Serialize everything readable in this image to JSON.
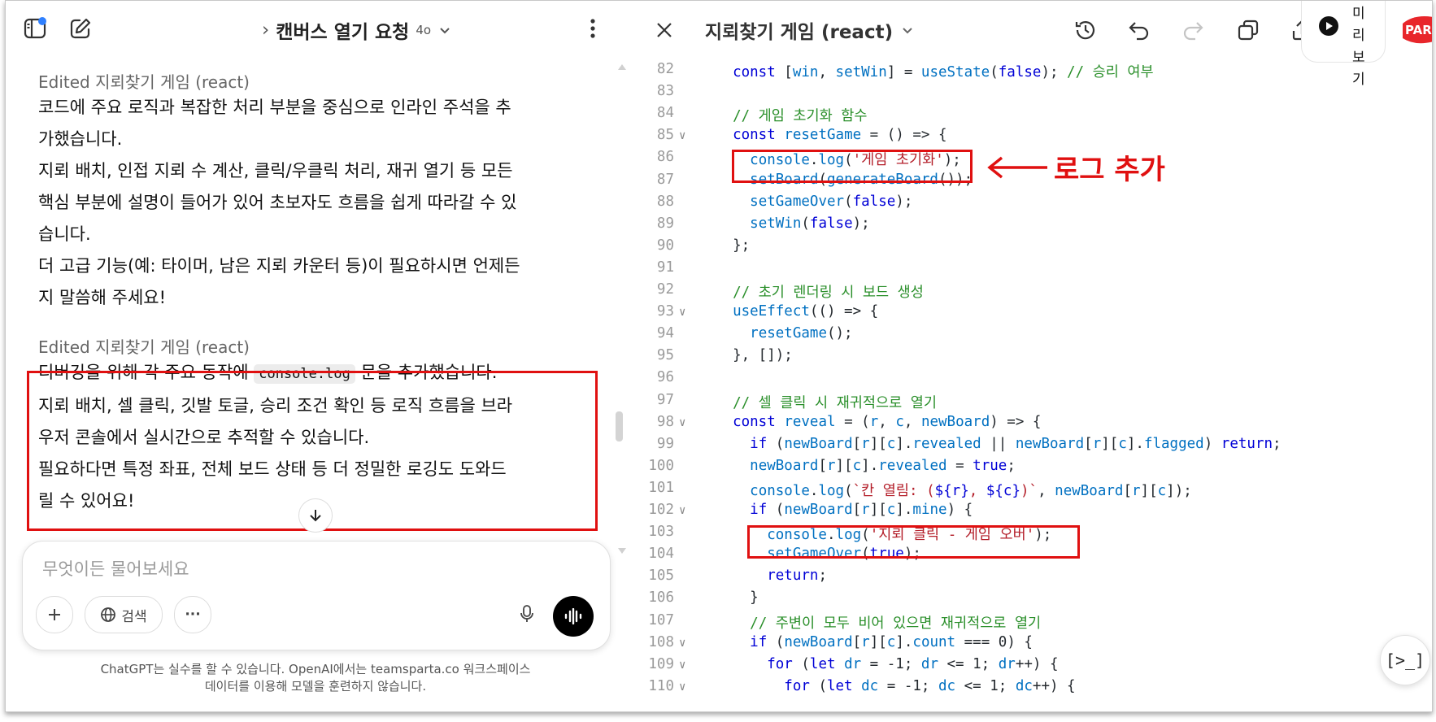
{
  "left": {
    "conversation_title": "캔버스 열기 요청",
    "model_badge": "4o",
    "breadcrumb_chevron": "›",
    "messages": [
      {
        "edited_label": "Edited 지뢰찾기 게임 (react)",
        "lines": [
          "코드에 주요 로직과 복잡한 처리 부분을 중심으로 인라인 주석을 추",
          "가했습니다.",
          "지뢰 배치, 인접 지뢰 수 계산, 클릭/우클릭 처리, 재귀 열기 등 모든",
          "핵심 부분에 설명이 들어가 있어 초보자도 흐름을 쉽게 따라갈 수 있",
          "습니다.",
          "더 고급 기능(예: 타이머, 남은 지뢰 카운터 등)이 필요하시면 언제든",
          "지 말씀해 주세요!"
        ]
      },
      {
        "edited_label": "Edited 지뢰찾기 게임 (react)",
        "line1_before": "디버깅을 위해 각 주요 동작에 ",
        "line1_code": "console.log",
        "line1_after": " 문을 추가했습니다.",
        "lines": [
          "지뢰 배치, 셀 클릭, 깃발 토글, 승리 조건 확인 등 로직 흐름을 브라",
          "우저 콘솔에서 실시간으로 추적할 수 있습니다.",
          "필요하다면 특정 좌표, 전체 보드 상태 등 더 정밀한 로깅도 도와드",
          "릴 수 있어요!"
        ]
      }
    ],
    "composer": {
      "placeholder": "무엇이든 물어보세요",
      "search_label": "검색",
      "more_label": "···"
    },
    "disclaimer": [
      "ChatGPT는 실수를 할 수 있습니다. OpenAI에서는 teamsparta.co 워크스페이스",
      "데이터를 이용해 모델을 훈련하지 않습니다."
    ]
  },
  "right": {
    "document_title": "지뢰찾기 게임 (react)",
    "run_pill_text": [
      "미",
      "리",
      "보",
      "기"
    ],
    "logo_text": "PAR",
    "code_lines": [
      {
        "n": "82",
        "fold": false,
        "tokens": [
          [
            "pl",
            "  "
          ],
          [
            "kw",
            "const"
          ],
          [
            "pl",
            " ["
          ],
          [
            "var",
            "win"
          ],
          [
            "pl",
            ", "
          ],
          [
            "var",
            "setWin"
          ],
          [
            "pl",
            "] = "
          ],
          [
            "var",
            "useState"
          ],
          [
            "pl",
            "("
          ],
          [
            "kw",
            "false"
          ],
          [
            "pl",
            "); "
          ],
          [
            "cm",
            "// 승리 여부"
          ]
        ]
      },
      {
        "n": "83",
        "fold": false,
        "tokens": []
      },
      {
        "n": "84",
        "fold": false,
        "tokens": [
          [
            "pl",
            "  "
          ],
          [
            "cm",
            "// 게임 초기화 함수"
          ]
        ]
      },
      {
        "n": "85",
        "fold": true,
        "tokens": [
          [
            "pl",
            "  "
          ],
          [
            "kw",
            "const"
          ],
          [
            "pl",
            " "
          ],
          [
            "var",
            "resetGame"
          ],
          [
            "pl",
            " = () => {"
          ]
        ]
      },
      {
        "n": "86",
        "fold": false,
        "tokens": [
          [
            "pl",
            "    "
          ],
          [
            "var",
            "console"
          ],
          [
            "pl",
            "."
          ],
          [
            "var",
            "log"
          ],
          [
            "pl",
            "("
          ],
          [
            "str",
            "'게임 초기화'"
          ],
          [
            "pl",
            ");"
          ]
        ]
      },
      {
        "n": "87",
        "fold": false,
        "tokens": [
          [
            "pl",
            "    "
          ],
          [
            "var",
            "setBoard"
          ],
          [
            "pl",
            "("
          ],
          [
            "var",
            "generateBoard"
          ],
          [
            "pl",
            "());"
          ]
        ]
      },
      {
        "n": "88",
        "fold": false,
        "tokens": [
          [
            "pl",
            "    "
          ],
          [
            "var",
            "setGameOver"
          ],
          [
            "pl",
            "("
          ],
          [
            "kw",
            "false"
          ],
          [
            "pl",
            ");"
          ]
        ]
      },
      {
        "n": "89",
        "fold": false,
        "tokens": [
          [
            "pl",
            "    "
          ],
          [
            "var",
            "setWin"
          ],
          [
            "pl",
            "("
          ],
          [
            "kw",
            "false"
          ],
          [
            "pl",
            ");"
          ]
        ]
      },
      {
        "n": "90",
        "fold": false,
        "tokens": [
          [
            "pl",
            "  };"
          ]
        ]
      },
      {
        "n": "91",
        "fold": false,
        "tokens": []
      },
      {
        "n": "92",
        "fold": false,
        "tokens": [
          [
            "pl",
            "  "
          ],
          [
            "cm",
            "// 초기 렌더링 시 보드 생성"
          ]
        ]
      },
      {
        "n": "93",
        "fold": true,
        "tokens": [
          [
            "pl",
            "  "
          ],
          [
            "var",
            "useEffect"
          ],
          [
            "pl",
            "(() => {"
          ]
        ]
      },
      {
        "n": "94",
        "fold": false,
        "tokens": [
          [
            "pl",
            "    "
          ],
          [
            "var",
            "resetGame"
          ],
          [
            "pl",
            "();"
          ]
        ]
      },
      {
        "n": "95",
        "fold": false,
        "tokens": [
          [
            "pl",
            "  }, []);"
          ]
        ]
      },
      {
        "n": "96",
        "fold": false,
        "tokens": []
      },
      {
        "n": "97",
        "fold": false,
        "tokens": [
          [
            "pl",
            "  "
          ],
          [
            "cm",
            "// 셀 클릭 시 재귀적으로 열기"
          ]
        ]
      },
      {
        "n": "98",
        "fold": true,
        "tokens": [
          [
            "pl",
            "  "
          ],
          [
            "kw",
            "const"
          ],
          [
            "pl",
            " "
          ],
          [
            "var",
            "reveal"
          ],
          [
            "pl",
            " = ("
          ],
          [
            "var",
            "r"
          ],
          [
            "pl",
            ", "
          ],
          [
            "var",
            "c"
          ],
          [
            "pl",
            ", "
          ],
          [
            "var",
            "newBoard"
          ],
          [
            "pl",
            ") => {"
          ]
        ]
      },
      {
        "n": "99",
        "fold": false,
        "tokens": [
          [
            "pl",
            "    "
          ],
          [
            "kw",
            "if"
          ],
          [
            "pl",
            " ("
          ],
          [
            "var",
            "newBoard"
          ],
          [
            "pl",
            "["
          ],
          [
            "var",
            "r"
          ],
          [
            "pl",
            "]["
          ],
          [
            "var",
            "c"
          ],
          [
            "pl",
            "]."
          ],
          [
            "var",
            "revealed"
          ],
          [
            "pl",
            " || "
          ],
          [
            "var",
            "newBoard"
          ],
          [
            "pl",
            "["
          ],
          [
            "var",
            "r"
          ],
          [
            "pl",
            "]["
          ],
          [
            "var",
            "c"
          ],
          [
            "pl",
            "]."
          ],
          [
            "var",
            "flagged"
          ],
          [
            "pl",
            ") "
          ],
          [
            "kw",
            "return"
          ],
          [
            "pl",
            ";"
          ]
        ]
      },
      {
        "n": "100",
        "fold": false,
        "tokens": [
          [
            "pl",
            "    "
          ],
          [
            "var",
            "newBoard"
          ],
          [
            "pl",
            "["
          ],
          [
            "var",
            "r"
          ],
          [
            "pl",
            "]["
          ],
          [
            "var",
            "c"
          ],
          [
            "pl",
            "]."
          ],
          [
            "var",
            "revealed"
          ],
          [
            "pl",
            " = "
          ],
          [
            "kw",
            "true"
          ],
          [
            "pl",
            ";"
          ]
        ]
      },
      {
        "n": "101",
        "fold": false,
        "tokens": [
          [
            "pl",
            "    "
          ],
          [
            "var",
            "console"
          ],
          [
            "pl",
            "."
          ],
          [
            "var",
            "log"
          ],
          [
            "pl",
            "("
          ],
          [
            "str",
            "`칸 열림: ("
          ],
          [
            "kw",
            "${r}"
          ],
          [
            "str",
            ", "
          ],
          [
            "kw",
            "${c}"
          ],
          [
            "str",
            ")`"
          ],
          [
            "pl",
            ", "
          ],
          [
            "var",
            "newBoard"
          ],
          [
            "pl",
            "["
          ],
          [
            "var",
            "r"
          ],
          [
            "pl",
            "]["
          ],
          [
            "var",
            "c"
          ],
          [
            "pl",
            "]);"
          ]
        ]
      },
      {
        "n": "102",
        "fold": true,
        "tokens": [
          [
            "pl",
            "    "
          ],
          [
            "kw",
            "if"
          ],
          [
            "pl",
            " ("
          ],
          [
            "var",
            "newBoard"
          ],
          [
            "pl",
            "["
          ],
          [
            "var",
            "r"
          ],
          [
            "pl",
            "]["
          ],
          [
            "var",
            "c"
          ],
          [
            "pl",
            "]."
          ],
          [
            "var",
            "mine"
          ],
          [
            "pl",
            ") {"
          ]
        ]
      },
      {
        "n": "103",
        "fold": false,
        "tokens": [
          [
            "pl",
            "      "
          ],
          [
            "var",
            "console"
          ],
          [
            "pl",
            "."
          ],
          [
            "var",
            "log"
          ],
          [
            "pl",
            "("
          ],
          [
            "str",
            "'지뢰 클릭 - 게임 오버'"
          ],
          [
            "pl",
            ");"
          ]
        ]
      },
      {
        "n": "104",
        "fold": false,
        "tokens": [
          [
            "pl",
            "      "
          ],
          [
            "var",
            "setGameOver"
          ],
          [
            "pl",
            "("
          ],
          [
            "kw",
            "true"
          ],
          [
            "pl",
            ");"
          ]
        ]
      },
      {
        "n": "105",
        "fold": false,
        "tokens": [
          [
            "pl",
            "      "
          ],
          [
            "kw",
            "return"
          ],
          [
            "pl",
            ";"
          ]
        ]
      },
      {
        "n": "106",
        "fold": false,
        "tokens": [
          [
            "pl",
            "    }"
          ]
        ]
      },
      {
        "n": "107",
        "fold": false,
        "tokens": [
          [
            "pl",
            "    "
          ],
          [
            "cm",
            "// 주변이 모두 비어 있으면 재귀적으로 열기"
          ]
        ]
      },
      {
        "n": "108",
        "fold": true,
        "tokens": [
          [
            "pl",
            "    "
          ],
          [
            "kw",
            "if"
          ],
          [
            "pl",
            " ("
          ],
          [
            "var",
            "newBoard"
          ],
          [
            "pl",
            "["
          ],
          [
            "var",
            "r"
          ],
          [
            "pl",
            "]["
          ],
          [
            "var",
            "c"
          ],
          [
            "pl",
            "]."
          ],
          [
            "var",
            "count"
          ],
          [
            "pl",
            " === "
          ],
          [
            "pl",
            "0) {"
          ]
        ]
      },
      {
        "n": "109",
        "fold": true,
        "tokens": [
          [
            "pl",
            "      "
          ],
          [
            "kw",
            "for"
          ],
          [
            "pl",
            " ("
          ],
          [
            "kw",
            "let"
          ],
          [
            "pl",
            " "
          ],
          [
            "var",
            "dr"
          ],
          [
            "pl",
            " = -1; "
          ],
          [
            "var",
            "dr"
          ],
          [
            "pl",
            " <= 1; "
          ],
          [
            "var",
            "dr"
          ],
          [
            "pl",
            "++) {"
          ]
        ]
      },
      {
        "n": "110",
        "fold": true,
        "tokens": [
          [
            "pl",
            "        "
          ],
          [
            "kw",
            "for"
          ],
          [
            "pl",
            " ("
          ],
          [
            "kw",
            "let"
          ],
          [
            "pl",
            " "
          ],
          [
            "var",
            "dc"
          ],
          [
            "pl",
            " = -1; "
          ],
          [
            "var",
            "dc"
          ],
          [
            "pl",
            " <= 1; "
          ],
          [
            "var",
            "dc"
          ],
          [
            "pl",
            "++) {"
          ]
        ]
      }
    ],
    "annotation": "로그 추가",
    "console_button_label": "[>_]"
  },
  "colors": {
    "highlight_red": "#e01010",
    "keyword_blue": "#0000d6",
    "variable_blue": "#0070c1",
    "string_red": "#b31d28",
    "comment_green": "#2a8f2a"
  }
}
